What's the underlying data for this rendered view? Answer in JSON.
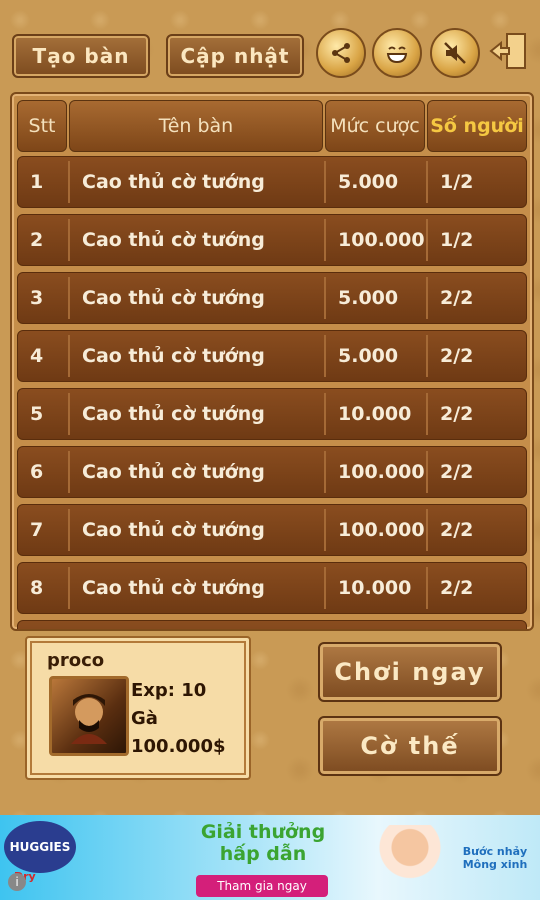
{
  "toolbar": {
    "create_table": "Tạo bàn",
    "refresh": "Cập nhật",
    "share_icon": "share-icon",
    "emoji_icon": "smile-icon",
    "mute_icon": "sound-muted-icon",
    "exit_icon": "exit-door-icon"
  },
  "table": {
    "headers": {
      "stt": "Stt",
      "name": "Tên bàn",
      "bet": "Mức cược",
      "players": "Số người"
    },
    "rows": [
      {
        "stt": "1",
        "name": "Cao thủ cờ tướng",
        "bet": "5.000",
        "players": "1/2"
      },
      {
        "stt": "2",
        "name": "Cao thủ cờ tướng",
        "bet": "100.000",
        "players": "1/2"
      },
      {
        "stt": "3",
        "name": "Cao thủ cờ tướng",
        "bet": "5.000",
        "players": "2/2"
      },
      {
        "stt": "4",
        "name": "Cao thủ cờ tướng",
        "bet": "5.000",
        "players": "2/2"
      },
      {
        "stt": "5",
        "name": "Cao thủ cờ tướng",
        "bet": "10.000",
        "players": "2/2"
      },
      {
        "stt": "6",
        "name": "Cao thủ cờ tướng",
        "bet": "100.000",
        "players": "2/2"
      },
      {
        "stt": "7",
        "name": "Cao thủ cờ tướng",
        "bet": "100.000",
        "players": "2/2"
      },
      {
        "stt": "8",
        "name": "Cao thủ cờ tướng",
        "bet": "10.000",
        "players": "2/2"
      }
    ]
  },
  "player": {
    "name": "proco",
    "exp": "Exp: 10",
    "rank": "Gà",
    "money": "100.000$"
  },
  "actions": {
    "play_now": "Chơi ngay",
    "puzzle": "Cờ thế"
  },
  "ad": {
    "brand": "HUGGIES",
    "brand_sub": "Dry",
    "headline_1": "Giải thưởng",
    "headline_2": "hấp dẫn",
    "cta": "Tham gia ngay",
    "promo": "Bước nhảy Mông xinh"
  },
  "colors": {
    "accent_header": "#f5c842",
    "row_bg": "#7a4419",
    "panel_bg": "#c58e4a"
  }
}
